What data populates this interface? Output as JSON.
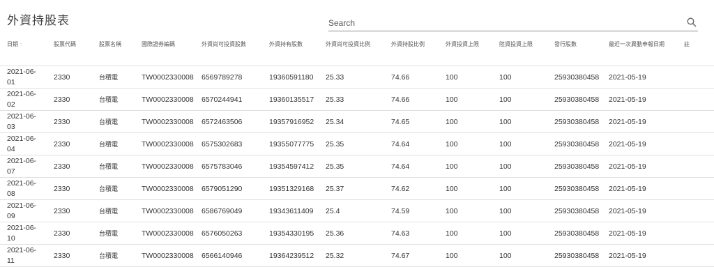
{
  "page": {
    "title": "外資持股表"
  },
  "search": {
    "placeholder": "Search"
  },
  "table": {
    "headers": [
      "日期",
      "股票代碼",
      "股票名稱",
      "國際證券編碼",
      "外資尚可投資股數",
      "外資持有股數",
      "外資尚可投資比例",
      "外資持股比例",
      "外資投資上限",
      "陸資投資上限",
      "發行股數",
      "最近一次異動申報日期",
      "註"
    ],
    "sort_indicator": "↑",
    "rows": [
      {
        "date": "2021-06-01",
        "code": "2330",
        "name": "台積電",
        "isin": "TW0002330008",
        "available": "6569789278",
        "held": "19360591180",
        "available_pct": "25.33",
        "held_pct": "74.66",
        "foreign_limit": "100",
        "china_limit": "100",
        "issued": "25930380458",
        "last_change": "2021-05-19",
        "note": ""
      },
      {
        "date": "2021-06-02",
        "code": "2330",
        "name": "台積電",
        "isin": "TW0002330008",
        "available": "6570244941",
        "held": "19360135517",
        "available_pct": "25.33",
        "held_pct": "74.66",
        "foreign_limit": "100",
        "china_limit": "100",
        "issued": "25930380458",
        "last_change": "2021-05-19",
        "note": ""
      },
      {
        "date": "2021-06-03",
        "code": "2330",
        "name": "台積電",
        "isin": "TW0002330008",
        "available": "6572463506",
        "held": "19357916952",
        "available_pct": "25.34",
        "held_pct": "74.65",
        "foreign_limit": "100",
        "china_limit": "100",
        "issued": "25930380458",
        "last_change": "2021-05-19",
        "note": ""
      },
      {
        "date": "2021-06-04",
        "code": "2330",
        "name": "台積電",
        "isin": "TW0002330008",
        "available": "6575302683",
        "held": "19355077775",
        "available_pct": "25.35",
        "held_pct": "74.64",
        "foreign_limit": "100",
        "china_limit": "100",
        "issued": "25930380458",
        "last_change": "2021-05-19",
        "note": ""
      },
      {
        "date": "2021-06-07",
        "code": "2330",
        "name": "台積電",
        "isin": "TW0002330008",
        "available": "6575783046",
        "held": "19354597412",
        "available_pct": "25.35",
        "held_pct": "74.64",
        "foreign_limit": "100",
        "china_limit": "100",
        "issued": "25930380458",
        "last_change": "2021-05-19",
        "note": ""
      },
      {
        "date": "2021-06-08",
        "code": "2330",
        "name": "台積電",
        "isin": "TW0002330008",
        "available": "6579051290",
        "held": "19351329168",
        "available_pct": "25.37",
        "held_pct": "74.62",
        "foreign_limit": "100",
        "china_limit": "100",
        "issued": "25930380458",
        "last_change": "2021-05-19",
        "note": ""
      },
      {
        "date": "2021-06-09",
        "code": "2330",
        "name": "台積電",
        "isin": "TW0002330008",
        "available": "6586769049",
        "held": "19343611409",
        "available_pct": "25.4",
        "held_pct": "74.59",
        "foreign_limit": "100",
        "china_limit": "100",
        "issued": "25930380458",
        "last_change": "2021-05-19",
        "note": ""
      },
      {
        "date": "2021-06-10",
        "code": "2330",
        "name": "台積電",
        "isin": "TW0002330008",
        "available": "6576050263",
        "held": "19354330195",
        "available_pct": "25.36",
        "held_pct": "74.63",
        "foreign_limit": "100",
        "china_limit": "100",
        "issued": "25930380458",
        "last_change": "2021-05-19",
        "note": ""
      },
      {
        "date": "2021-06-11",
        "code": "2330",
        "name": "台積電",
        "isin": "TW0002330008",
        "available": "6566140946",
        "held": "19364239512",
        "available_pct": "25.32",
        "held_pct": "74.67",
        "foreign_limit": "100",
        "china_limit": "100",
        "issued": "25930380458",
        "last_change": "2021-05-19",
        "note": ""
      }
    ]
  }
}
